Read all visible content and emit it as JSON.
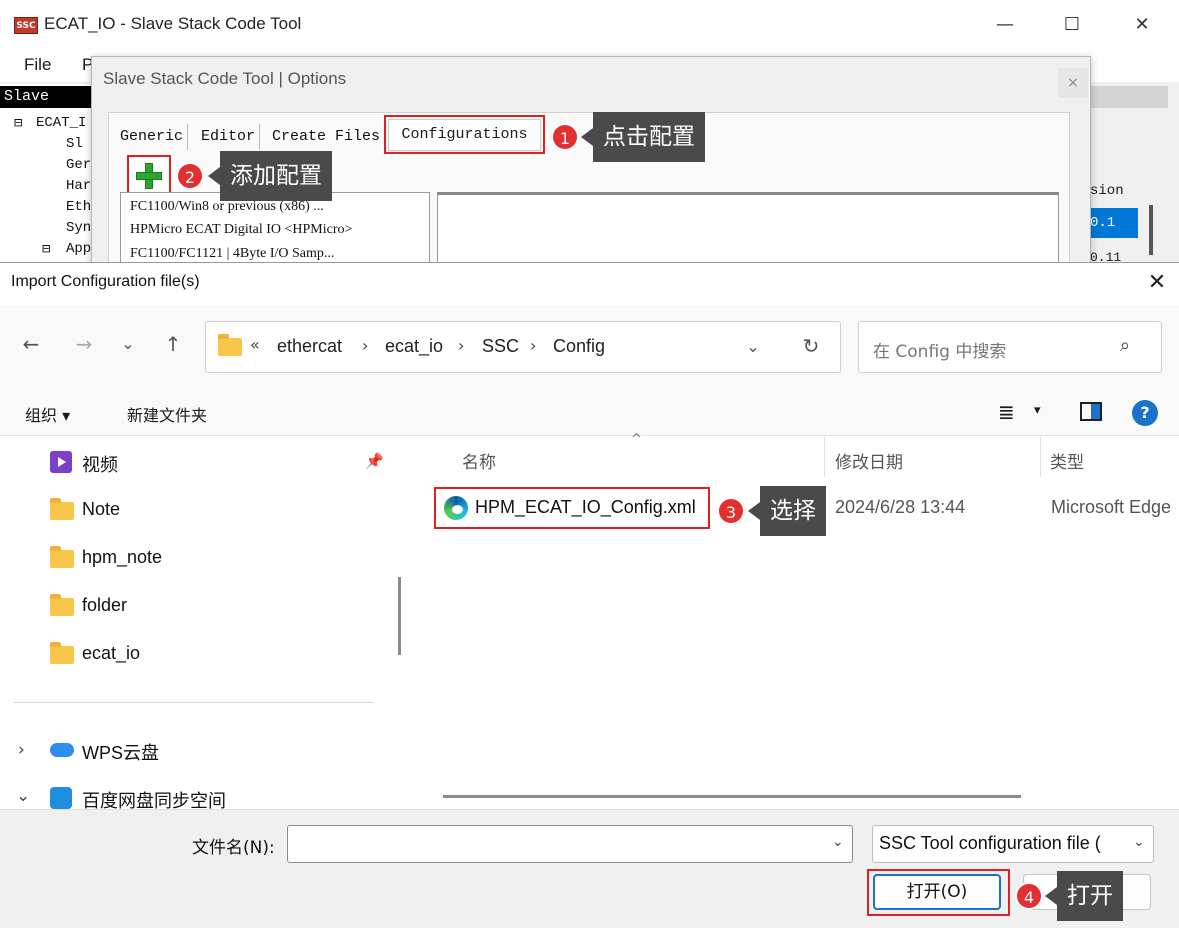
{
  "main_window": {
    "logo_text": "SSC",
    "title": "ECAT_IO - Slave Stack Code Tool",
    "controls": {
      "minimize": "—",
      "maximize": "☐",
      "close": "✕"
    },
    "menu": [
      "File",
      "P"
    ],
    "tree": {
      "header": "Slave Proj",
      "root": "ECAT_I",
      "children": [
        "Sl",
        "Ger",
        "Har",
        "Eth",
        "Syn",
        "App"
      ]
    },
    "version_column": {
      "header": "sion",
      "selected": "0.1",
      "next": "0.11"
    }
  },
  "options_dialog": {
    "title": "Slave Stack Code Tool | Options",
    "close": "×",
    "tabs": [
      "Generic",
      "Editor",
      "Create Files",
      "Configurations"
    ],
    "configurations": [
      "FC1100/Win8 or previous (x86) ...",
      "HPMicro ECAT Digital IO <HPMicro>",
      "FC1100/FC1121 | 4Byte I/O Samp..."
    ]
  },
  "annotations": [
    {
      "number": "1",
      "text": "点击配置"
    },
    {
      "number": "2",
      "text": "添加配置"
    },
    {
      "number": "3",
      "text": "选择"
    },
    {
      "number": "4",
      "text": "打开"
    }
  ],
  "import_dialog": {
    "title": "Import Configuration file(s)",
    "close": "✕",
    "nav": {
      "back": "←",
      "forward": "→",
      "recent": "⌄",
      "up": "↑",
      "refresh": "↻",
      "dropdown": "⌄"
    },
    "breadcrumb_prefix": "«",
    "breadcrumb": [
      "ethercat",
      "ecat_io",
      "SSC",
      "Config"
    ],
    "breadcrumb_sep": "›",
    "search_placeholder": "在 Config 中搜索",
    "search_icon": "⌕",
    "toolbar": {
      "organize": "组织 ▾",
      "new_folder": "新建文件夹",
      "view_list": "≣",
      "view_dropdown": "▾",
      "help": "?"
    },
    "sidebar": {
      "pin": "📌",
      "items": [
        "视频",
        "Note",
        "hpm_note",
        "folder",
        "ecat_io"
      ],
      "drives": [
        {
          "chevron": "›",
          "label": "WPS云盘"
        },
        {
          "chevron": "⌄",
          "label": "百度网盘同步空间"
        }
      ]
    },
    "columns": {
      "sort": "^",
      "name": "名称",
      "date": "修改日期",
      "type": "类型"
    },
    "files": [
      {
        "name": "HPM_ECAT_IO_Config.xml",
        "date": "2024/6/28 13:44",
        "type": "Microsoft Edge"
      }
    ],
    "filename_label": "文件名(N):",
    "filename_value": "",
    "filename_chevron": "⌄",
    "filetype": "SSC Tool configuration file (",
    "filetype_chevron": "⌄",
    "open_button": "打开(O)"
  },
  "colors": {
    "highlight": "#e02020",
    "badge": "#e23030",
    "callout": "#4a4a4a",
    "accent": "#1a73c9"
  }
}
